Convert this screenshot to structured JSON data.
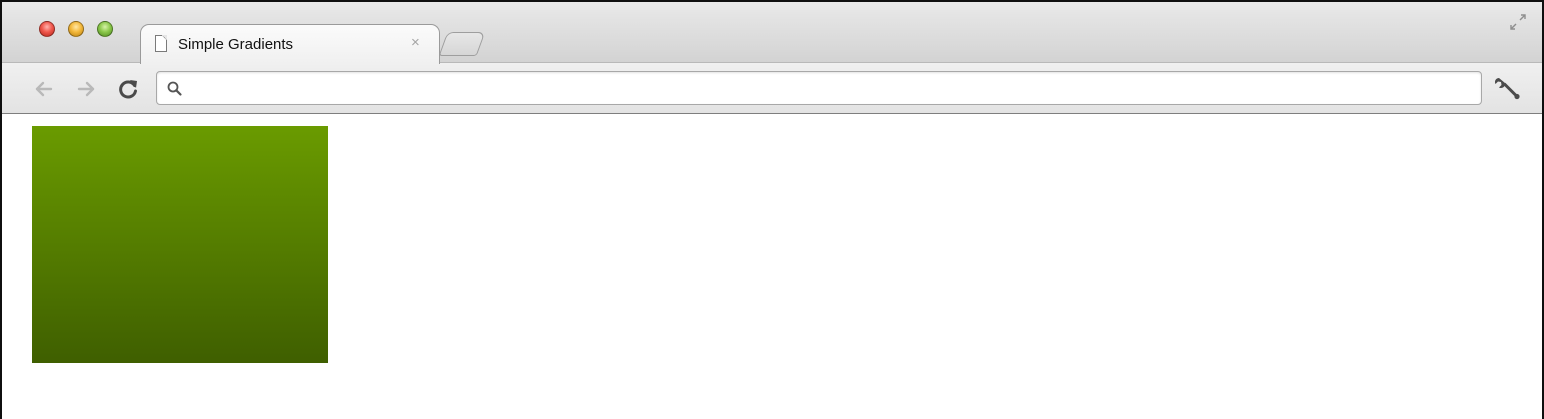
{
  "window": {
    "tab": {
      "title": "Simple Gradients",
      "close_glyph": "×",
      "icon": "document-icon"
    },
    "traffic_lights": {
      "close_color": "#f0584d",
      "minimize_color": "#f4b93c",
      "zoom_color": "#8cc94b"
    }
  },
  "toolbar": {
    "back_icon": "arrow-left-icon",
    "forward_icon": "arrow-right-icon",
    "reload_icon": "reload-icon",
    "omnibox": {
      "value": "",
      "placeholder": "",
      "icon": "search-icon"
    },
    "menu_icon": "wrench-icon"
  },
  "page": {
    "gradient_box": {
      "color_top": "#6a9b00",
      "color_bottom": "#3f5f00",
      "direction": "top-to-bottom"
    }
  }
}
